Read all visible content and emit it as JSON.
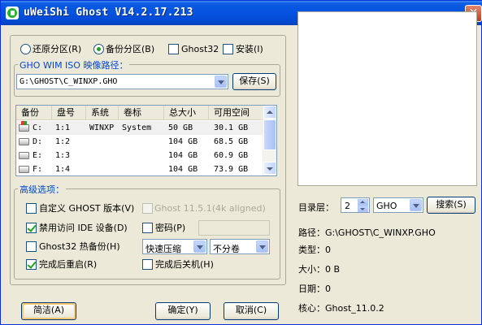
{
  "window": {
    "title": "uWeiShi Ghost V14.2.17.213",
    "close_glyph": "✕"
  },
  "mode": {
    "restore_label": "还原分区(R)",
    "backup_label": "备份分区(B)",
    "ghost32_label": "Ghost32",
    "install_label": "安装(I)",
    "selected": "backup"
  },
  "image_path": {
    "group_label": "GHO WIM ISO 映像路径：",
    "value": "G:\\GHOST\\C_WINXP.GHO",
    "save_button": "保存(S)"
  },
  "partitions": {
    "columns": [
      "备份",
      "盘号",
      "系统",
      "卷标",
      "总大小",
      "可用空间"
    ],
    "rows": [
      {
        "drive": "C:",
        "disk": "1:1",
        "system": "WINXP",
        "label": "System",
        "total": "50 GB",
        "free": "30.1 GB",
        "icon": "system-drive-icon",
        "selected": true
      },
      {
        "drive": "D:",
        "disk": "1:2",
        "system": "",
        "label": "",
        "total": "104 GB",
        "free": "68.5 GB",
        "icon": "drive-icon",
        "selected": false
      },
      {
        "drive": "E:",
        "disk": "1:3",
        "system": "",
        "label": "",
        "total": "104 GB",
        "free": "60.9 GB",
        "icon": "drive-icon",
        "selected": false
      },
      {
        "drive": "F:",
        "disk": "1:4",
        "system": "",
        "label": "",
        "total": "104 GB",
        "free": "73.9 GB",
        "icon": "drive-icon",
        "selected": false
      }
    ]
  },
  "advanced": {
    "group_label": "高级选项：",
    "custom_ghost_label": "自定义 GHOST 版本(V)",
    "custom_ghost_checked": false,
    "ghost_version_label": "Ghost 11.5.1(4k aligned)",
    "disable_ide_label": "禁用访问 IDE 设备(D)",
    "disable_ide_checked": true,
    "password_label": "密码(P)",
    "password_checked": false,
    "ghost32_hot_label": "Ghost32 热备份(H)",
    "ghost32_hot_checked": false,
    "compression_value": "快速压缩",
    "split_value": "不分卷",
    "reboot_label": "完成后重启(R)",
    "reboot_checked": true,
    "shutdown_label": "完成后关机(H)",
    "shutdown_checked": false
  },
  "catalog": {
    "layer_label": "目录层：",
    "layer_value": "2",
    "type_value": "GHO",
    "search_button": "搜索(S)"
  },
  "info": {
    "path": "路径：G:\\GHOST\\C_WINXP.GHO",
    "type": "类型：0",
    "size": "大小：0 B",
    "date": "日期：0",
    "core": "核心：Ghost_11.0.2"
  },
  "buttons": {
    "simple": "简洁(A)",
    "ok": "确定(Y)",
    "cancel": "取消(C)"
  }
}
